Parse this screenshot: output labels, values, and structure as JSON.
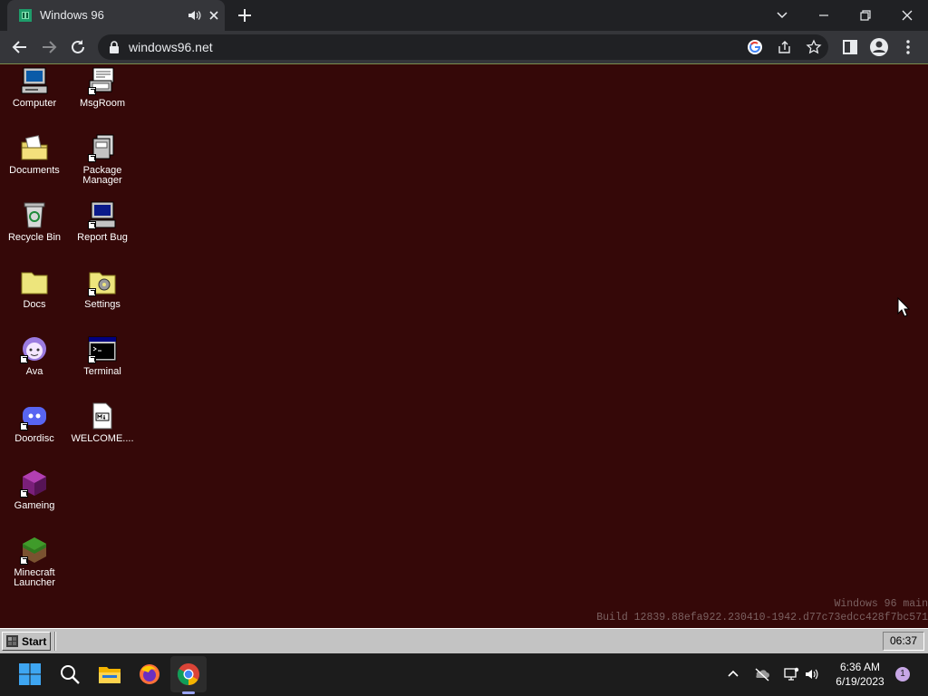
{
  "browser": {
    "tab": {
      "title": "Windows 96"
    },
    "address": {
      "url": "windows96.net"
    }
  },
  "desktop": {
    "background_color": "#350808",
    "icons": [
      {
        "label": "Computer",
        "icon": "computer-icon"
      },
      {
        "label": "MsgRoom",
        "icon": "msgroom-icon"
      },
      {
        "label": "Documents",
        "icon": "documents-folder-icon"
      },
      {
        "label": "Package\nManager",
        "icon": "package-manager-icon"
      },
      {
        "label": "Recycle Bin",
        "icon": "recycle-bin-icon"
      },
      {
        "label": "Report Bug",
        "icon": "report-bug-icon"
      },
      {
        "label": "Docs",
        "icon": "folder-icon"
      },
      {
        "label": "Settings",
        "icon": "settings-icon"
      },
      {
        "label": "Ava",
        "icon": "ava-icon"
      },
      {
        "label": "Terminal",
        "icon": "terminal-icon"
      },
      {
        "label": "Doordisc",
        "icon": "doordisc-icon"
      },
      {
        "label": "WELCOME....",
        "icon": "markdown-file-icon"
      },
      {
        "label": "Gameing",
        "icon": "gameing-icon"
      },
      {
        "label": "Minecraft\nLauncher",
        "icon": "minecraft-icon"
      }
    ],
    "build_line1": "Windows 96 main",
    "build_line2": "Build 12839.88efa922.230410-1942.d77c73edcc428f7bc571"
  },
  "w96_taskbar": {
    "start_label": "Start",
    "clock": "06:37"
  },
  "win_taskbar": {
    "time": "6:36 AM",
    "date": "6/19/2023",
    "notification_count": "1"
  }
}
